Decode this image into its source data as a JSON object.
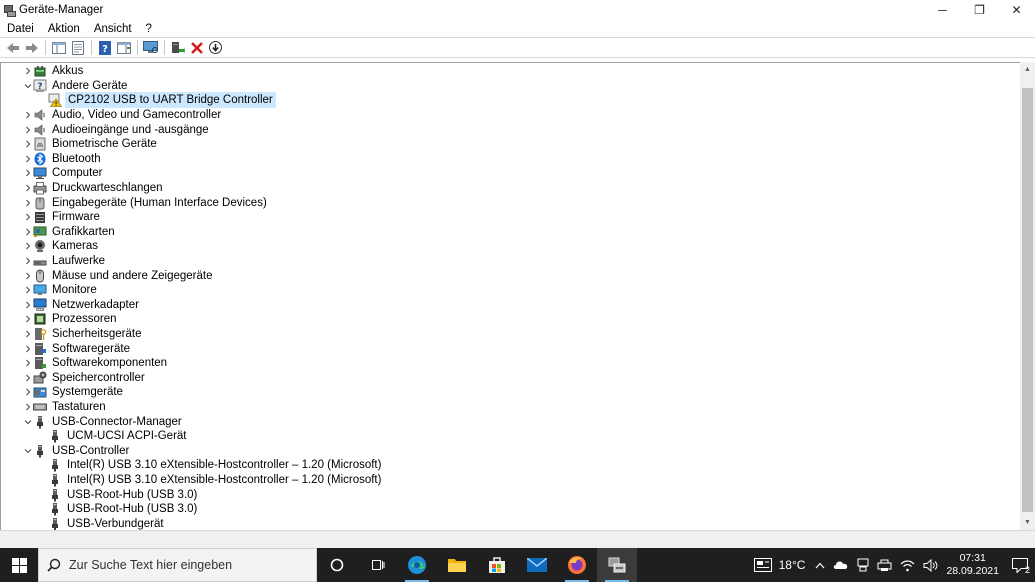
{
  "window": {
    "title": "Geräte-Manager",
    "controls": {
      "minimize": "─",
      "restore": "❐",
      "close": "✕"
    }
  },
  "menu": [
    "Datei",
    "Aktion",
    "Ansicht",
    "?"
  ],
  "toolbar": {
    "buttons": [
      "back-icon",
      "forward-icon",
      "show-hide-console-tree-icon",
      "properties-icon",
      "help-icon",
      "action-pane-icon",
      "monitor-scan-icon",
      "update-driver-icon",
      "uninstall-device-icon",
      "download-icon"
    ]
  },
  "tree": {
    "items": [
      {
        "label": "Akkus",
        "level": 1,
        "expander": "collapsed",
        "icon": "battery-icon"
      },
      {
        "label": "Andere Geräte",
        "level": 1,
        "expander": "expanded",
        "icon": "unknown-device-icon"
      },
      {
        "label": "CP2102 USB to UART Bridge Controller",
        "level": 2,
        "expander": "none",
        "icon": "warning-device-icon",
        "selected": true
      },
      {
        "label": "Audio, Video und Gamecontroller",
        "level": 1,
        "expander": "collapsed",
        "icon": "speaker-icon"
      },
      {
        "label": "Audioeingänge und -ausgänge",
        "level": 1,
        "expander": "collapsed",
        "icon": "speaker-icon"
      },
      {
        "label": "Biometrische Geräte",
        "level": 1,
        "expander": "collapsed",
        "icon": "biometric-icon"
      },
      {
        "label": "Bluetooth",
        "level": 1,
        "expander": "collapsed",
        "icon": "bluetooth-icon"
      },
      {
        "label": "Computer",
        "level": 1,
        "expander": "collapsed",
        "icon": "computer-icon"
      },
      {
        "label": "Druckwarteschlangen",
        "level": 1,
        "expander": "collapsed",
        "icon": "printer-icon"
      },
      {
        "label": "Eingabegeräte (Human Interface Devices)",
        "level": 1,
        "expander": "collapsed",
        "icon": "hid-icon"
      },
      {
        "label": "Firmware",
        "level": 1,
        "expander": "collapsed",
        "icon": "firmware-icon"
      },
      {
        "label": "Grafikkarten",
        "level": 1,
        "expander": "collapsed",
        "icon": "display-adapter-icon"
      },
      {
        "label": "Kameras",
        "level": 1,
        "expander": "collapsed",
        "icon": "camera-icon"
      },
      {
        "label": "Laufwerke",
        "level": 1,
        "expander": "collapsed",
        "icon": "drive-icon"
      },
      {
        "label": "Mäuse und andere Zeigegeräte",
        "level": 1,
        "expander": "collapsed",
        "icon": "mouse-icon"
      },
      {
        "label": "Monitore",
        "level": 1,
        "expander": "collapsed",
        "icon": "monitor-icon"
      },
      {
        "label": "Netzwerkadapter",
        "level": 1,
        "expander": "collapsed",
        "icon": "network-icon"
      },
      {
        "label": "Prozessoren",
        "level": 1,
        "expander": "collapsed",
        "icon": "processor-icon"
      },
      {
        "label": "Sicherheitsgeräte",
        "level": 1,
        "expander": "collapsed",
        "icon": "security-icon"
      },
      {
        "label": "Softwaregeräte",
        "level": 1,
        "expander": "collapsed",
        "icon": "software-device-icon"
      },
      {
        "label": "Softwarekomponenten",
        "level": 1,
        "expander": "collapsed",
        "icon": "software-component-icon"
      },
      {
        "label": "Speichercontroller",
        "level": 1,
        "expander": "collapsed",
        "icon": "storage-controller-icon"
      },
      {
        "label": "Systemgeräte",
        "level": 1,
        "expander": "collapsed",
        "icon": "system-device-icon"
      },
      {
        "label": "Tastaturen",
        "level": 1,
        "expander": "collapsed",
        "icon": "keyboard-icon"
      },
      {
        "label": "USB-Connector-Manager",
        "level": 1,
        "expander": "expanded",
        "icon": "usb-icon"
      },
      {
        "label": "UCM-UCSI ACPI-Gerät",
        "level": 2,
        "expander": "none",
        "icon": "usb-icon"
      },
      {
        "label": "USB-Controller",
        "level": 1,
        "expander": "expanded",
        "icon": "usb-icon"
      },
      {
        "label": "Intel(R) USB 3.10 eXtensible-Hostcontroller – 1.20 (Microsoft)",
        "level": 2,
        "expander": "none",
        "icon": "usb-icon"
      },
      {
        "label": "Intel(R) USB 3.10 eXtensible-Hostcontroller – 1.20 (Microsoft)",
        "level": 2,
        "expander": "none",
        "icon": "usb-icon"
      },
      {
        "label": "USB-Root-Hub (USB 3.0)",
        "level": 2,
        "expander": "none",
        "icon": "usb-icon"
      },
      {
        "label": "USB-Root-Hub (USB 3.0)",
        "level": 2,
        "expander": "none",
        "icon": "usb-icon"
      },
      {
        "label": "USB-Verbundgerät",
        "level": 2,
        "expander": "none",
        "icon": "usb-icon"
      }
    ]
  },
  "taskbar": {
    "search_placeholder": "Zur Suche Text hier eingeben",
    "apps": [
      "cortana-icon",
      "task-view-icon",
      "edge-icon",
      "file-explorer-icon",
      "store-icon",
      "mail-icon",
      "firefox-icon",
      "device-manager-icon"
    ],
    "tray": {
      "temperature": "18°C",
      "time": "07:31",
      "date": "28.09.2021",
      "notifications": "2"
    }
  },
  "colors": {
    "selection": "#cce8ff",
    "taskbar": "#1f1f1f",
    "accent": "#76b9ed"
  }
}
